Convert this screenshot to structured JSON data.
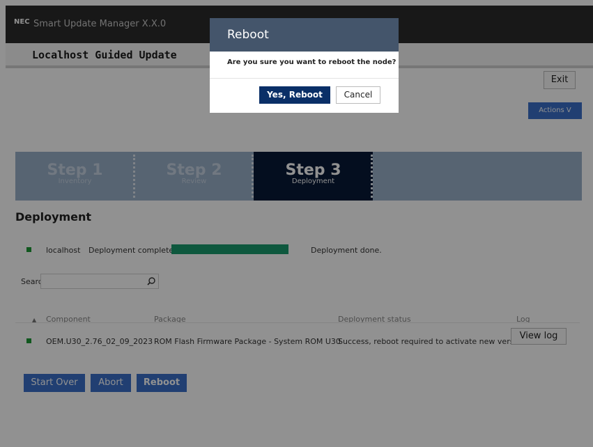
{
  "header": {
    "brand": "NEC",
    "app_title": "Smart Update Manager  X.X.0"
  },
  "subheader": {
    "title": "Localhost Guided Update"
  },
  "toolbar": {
    "exit_label": "Exit",
    "actions_label": "Actions  V"
  },
  "steps": [
    {
      "number": "Step 1",
      "label": "Inventory",
      "active": false
    },
    {
      "number": "Step 2",
      "label": "Review",
      "active": false
    },
    {
      "number": "Step 3",
      "label": "Deployment",
      "active": true
    }
  ],
  "deployment": {
    "title": "Deployment",
    "host": "localhost",
    "status": "Deployment completed",
    "progress": 1.0,
    "result": "Deployment done."
  },
  "search": {
    "label": "Search",
    "placeholder": ""
  },
  "table": {
    "sort_indicator": "▲",
    "headers": {
      "component": "Component",
      "package": "Package",
      "status": "Deployment status",
      "log": "Log"
    },
    "rows": [
      {
        "component": "OEM.U30_2.76_02_09_2023",
        "package": "ROM Flash Firmware Package - System ROM U30",
        "status": "Success, reboot required to activate new version.",
        "log_button": "View log"
      }
    ]
  },
  "bottom_buttons": {
    "start_over": "Start Over",
    "abort": "Abort",
    "reboot": "Reboot"
  },
  "dialog": {
    "title": "Reboot",
    "message": "Are you sure you want to reboot the node?",
    "confirm_label": "Yes, Reboot",
    "cancel_label": "Cancel"
  },
  "colors": {
    "accent": "#3a70c9",
    "active_step": "#081a38",
    "progress": "#1a9b6d",
    "status_ok": "#1d9a36",
    "dialog_header": "#44556b",
    "primary_button": "#0a2f67"
  }
}
